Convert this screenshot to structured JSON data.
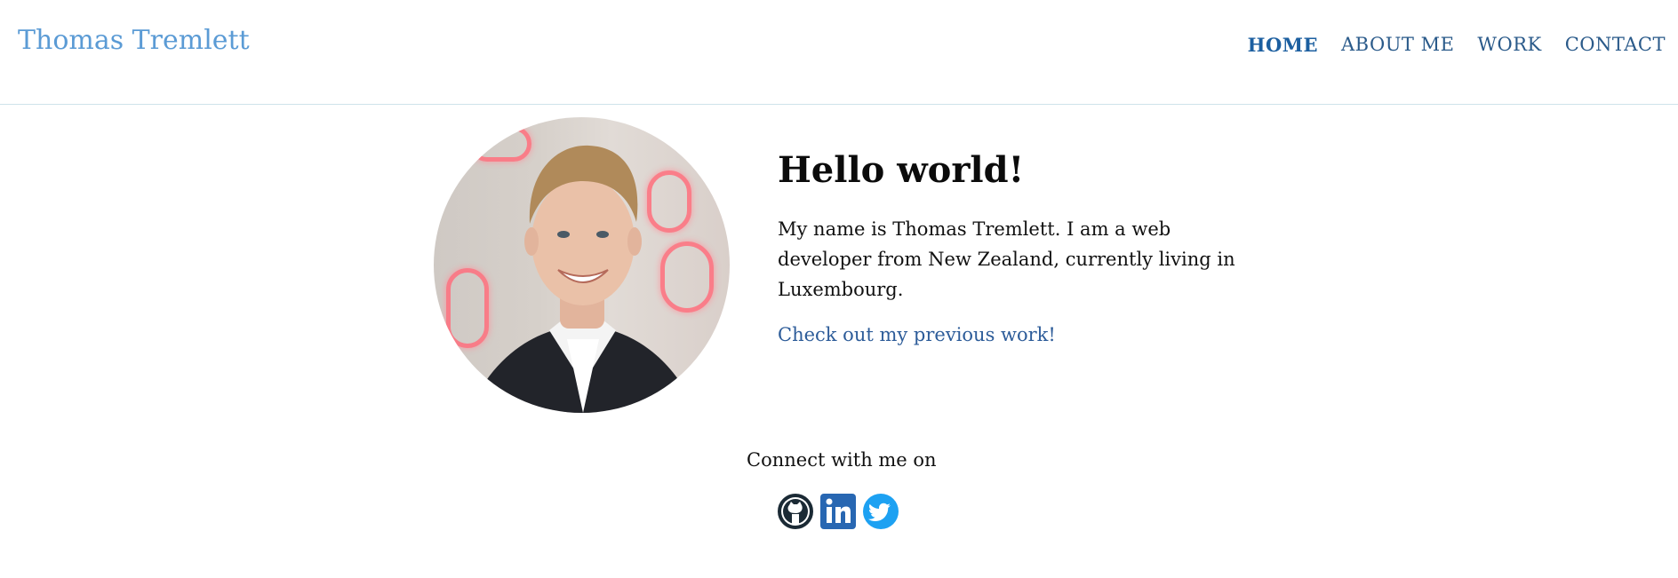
{
  "header": {
    "brand": "Thomas Tremlett",
    "nav": [
      {
        "label": "HOME",
        "active": true
      },
      {
        "label": "ABOUT ME",
        "active": false
      },
      {
        "label": "WORK",
        "active": false
      },
      {
        "label": "CONTACT",
        "active": false
      }
    ]
  },
  "intro": {
    "heading": "Hello world!",
    "paragraph": "My name is Thomas Tremlett. I am a web developer from New Zealand, currently living in Luxembourg.",
    "work_link": "Check out my previous work!"
  },
  "connect": {
    "label": "Connect with me on",
    "icons": [
      "github-icon",
      "linkedin-icon",
      "twitter-icon"
    ]
  },
  "colors": {
    "brand": "#5b9bd5",
    "nav": "#2a5a8a",
    "link": "#2d5c99",
    "github": "#1b2a35",
    "linkedin": "#2867b2",
    "twitter": "#1da1f2"
  }
}
